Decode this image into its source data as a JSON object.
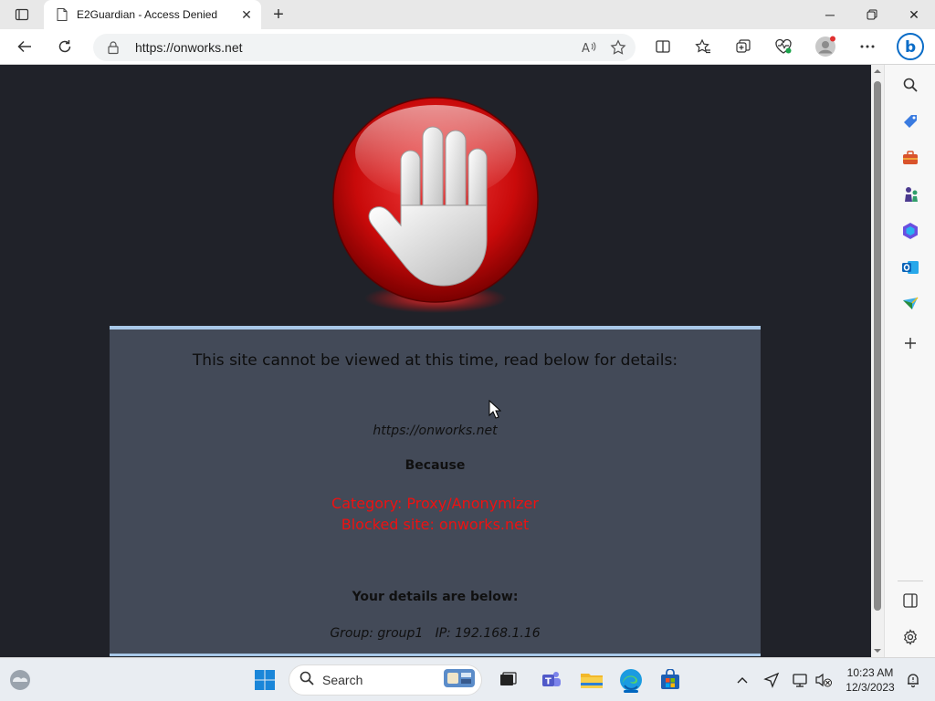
{
  "browser": {
    "tab_title": "E2Guardian - Access Denied",
    "url": "https://onworks.net"
  },
  "page": {
    "headline": "This site cannot be viewed at this time, read below for details:",
    "blocked_url": "https://onworks.net",
    "because_label": "Because",
    "category_line": "Category: Proxy/Anonymizer",
    "blocked_site_line": "Blocked site: onworks.net",
    "details_heading": "Your details are below:",
    "details_line": "Group: group1   IP: 192.168.1.16"
  },
  "taskbar": {
    "search_label": "Search",
    "time": "10:23 AM",
    "date": "12/3/2023"
  },
  "colors": {
    "page_background": "#202229",
    "panel_background": "#434a58",
    "panel_border": "#a8c8e8",
    "alert_red": "#ee1111",
    "accent_blue": "#0067c0"
  },
  "icons": [
    "tab-actions-icon",
    "page-favicon",
    "tab-close-icon",
    "new-tab-icon",
    "minimize-icon",
    "restore-icon",
    "window-close-icon",
    "back-icon",
    "refresh-icon",
    "lock-icon",
    "read-aloud-icon",
    "favorite-star-icon",
    "split-screen-icon",
    "favorites-icon",
    "collections-icon",
    "browser-essentials-icon",
    "profile-avatar-icon",
    "more-menu-icon",
    "copilot-icon",
    "stop-hand-icon",
    "sidebar-search-icon",
    "sidebar-shopping-icon",
    "sidebar-tools-icon",
    "sidebar-games-icon",
    "sidebar-office-icon",
    "sidebar-outlook-icon",
    "sidebar-drop-icon",
    "sidebar-add-icon",
    "sidebar-layout-icon",
    "sidebar-settings-icon",
    "weather-icon",
    "start-icon",
    "search-icon",
    "widgets-icon",
    "task-view-icon",
    "teams-icon",
    "file-explorer-icon",
    "edge-icon",
    "store-icon",
    "tray-chevron-icon",
    "location-icon",
    "display-icon",
    "volume-muted-icon",
    "notification-icon"
  ]
}
